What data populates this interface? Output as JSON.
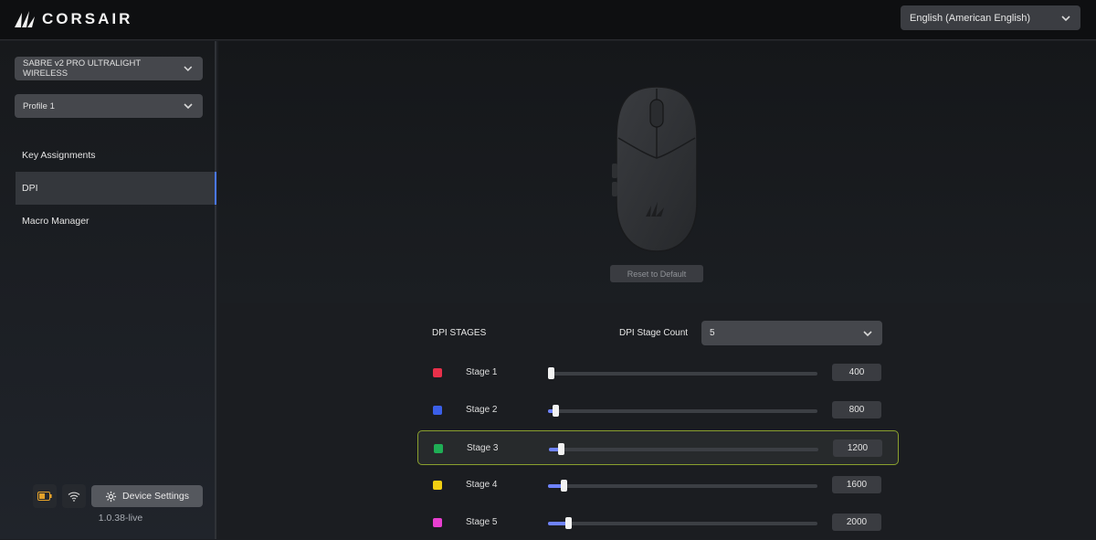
{
  "brand": {
    "name": "CORSAIR"
  },
  "language": {
    "selected": "English (American English)"
  },
  "sidebar": {
    "device_select": "SABRE v2 PRO ULTRALIGHT WIRELESS",
    "profile_select": "Profile 1",
    "items": [
      {
        "label": "Key Assignments",
        "active": false
      },
      {
        "label": "DPI",
        "active": true
      },
      {
        "label": "Macro Manager",
        "active": false
      }
    ],
    "device_settings_label": "Device Settings",
    "version": "1.0.38-live",
    "icons": [
      "battery-icon",
      "wifi-icon",
      "gear-icon"
    ]
  },
  "hero": {
    "reset_label": "Reset to Default"
  },
  "dpi": {
    "title": "DPI STAGES",
    "count_label": "DPI Stage Count",
    "count_value": "5",
    "slider_min": 100,
    "slider_max": 26000,
    "stages": [
      {
        "label": "Stage 1",
        "value": "400",
        "dpi": 400,
        "color": "#e8304a",
        "selected": false
      },
      {
        "label": "Stage 2",
        "value": "800",
        "dpi": 800,
        "color": "#3b5fe8",
        "selected": false
      },
      {
        "label": "Stage 3",
        "value": "1200",
        "dpi": 1200,
        "color": "#1fae55",
        "selected": true
      },
      {
        "label": "Stage 4",
        "value": "1600",
        "dpi": 1600,
        "color": "#f2cf12",
        "selected": false
      },
      {
        "label": "Stage 5",
        "value": "2000",
        "dpi": 2000,
        "color": "#e83fd0",
        "selected": false
      }
    ]
  },
  "colors": {
    "accent": "#4a78ff",
    "selected_border": "#8aa02e"
  }
}
